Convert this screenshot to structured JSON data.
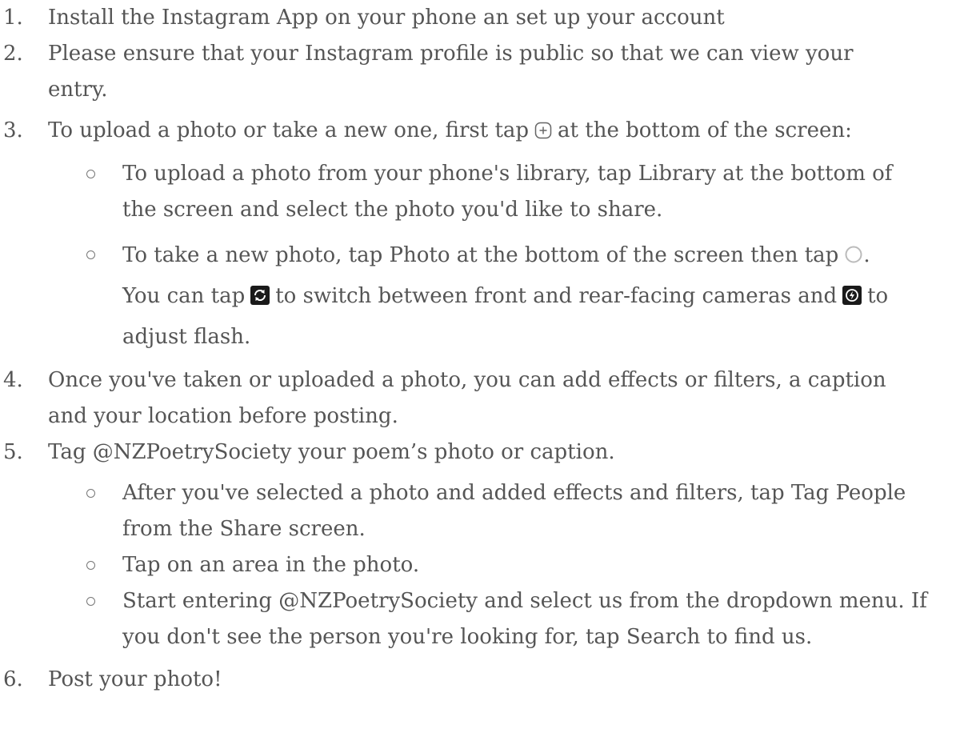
{
  "steps": [
    {
      "num": "1.",
      "text": "Install the Instagram App on your phone an set up your account"
    },
    {
      "num": "2.",
      "line1": "Please ensure that your Instagram profile is public so that we can view your",
      "line2": "entry."
    },
    {
      "num": "3.",
      "before": "To upload a photo or take a new one, first tap",
      "after": "at the bottom of the screen:",
      "icon": "plus-square-icon"
    },
    {
      "num": "4.",
      "line1": "Once you've taken or uploaded a photo, you can add effects or filters, a caption",
      "line2": "and your location before posting."
    },
    {
      "num": "5.",
      "text": "Tag @NZPoetrySociety your poem’s photo or caption."
    },
    {
      "num": "6.",
      "text": "Post your photo!"
    }
  ],
  "step3_sub": [
    {
      "line1": "To upload a photo from your phone's library, tap Library at the bottom of",
      "line2": "the screen and select the photo you'd like to share."
    },
    {
      "part1": "To take a new photo, tap Photo at the bottom of the screen then tap",
      "part1_end": ".",
      "part2": "You can tap",
      "part3": "to switch between front and rear-facing cameras and",
      "part4": "to",
      "line3": "adjust flash.",
      "icons": [
        "shutter-circle-icon",
        "switch-camera-icon",
        "flash-icon"
      ]
    }
  ],
  "step5_sub": [
    {
      "line1": "After you've selected a photo and added effects and filters, tap Tag People",
      "line2": "from the Share screen."
    },
    {
      "text": "Tap on an area in the photo."
    },
    {
      "line1": "Start entering @NZPoetrySociety and select us from the dropdown menu. If",
      "line2": "you don't see the person you're looking for, tap Search to find us."
    }
  ]
}
